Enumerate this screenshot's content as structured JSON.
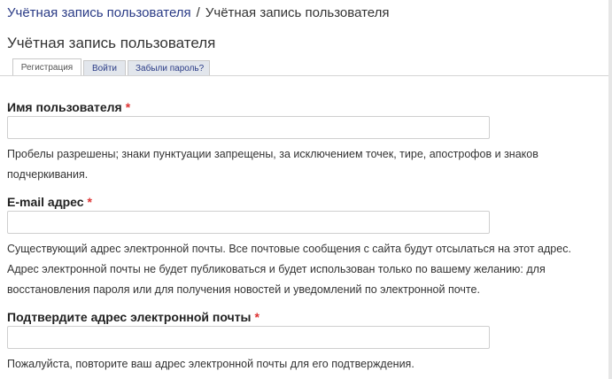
{
  "breadcrumb": {
    "link": "Учётная запись пользователя",
    "separator": "/",
    "current": "Учётная запись пользователя"
  },
  "page": {
    "title": "Учётная запись пользователя"
  },
  "tabs": [
    {
      "label": "Регистрация",
      "active": true
    },
    {
      "label": "Войти",
      "active": false
    },
    {
      "label": "Забыли пароль?",
      "active": false
    }
  ],
  "form": {
    "required_mark": "*",
    "username": {
      "label": "Имя пользователя",
      "value": "",
      "description_line1": "Пробелы разрешены; знаки пунктуации запрещены, за исключением точек, тире, апострофов и знаков",
      "description_line2": "подчеркивания."
    },
    "email": {
      "label": "E-mail адрес",
      "value": "",
      "description_line1": "Существующий адрес электронной почты. Все почтовые сообщения с сайта будут отсылаться на этот адрес.",
      "description_line2": "Адрес электронной почты не будет публиковаться и будет использован только по вашему желанию: для",
      "description_line3": "восстановления пароля или для получения новостей и уведомлений по электронной почте."
    },
    "email_confirm": {
      "label": "Подтвердите адрес электронной почты",
      "value": "",
      "description": "Пожалуйста, повторите ваш адрес электронной почты для его подтверждения."
    }
  },
  "colors": {
    "link": "#2a3b86",
    "required": "#d33",
    "tab_inactive_bg": "#e2e6ec"
  }
}
